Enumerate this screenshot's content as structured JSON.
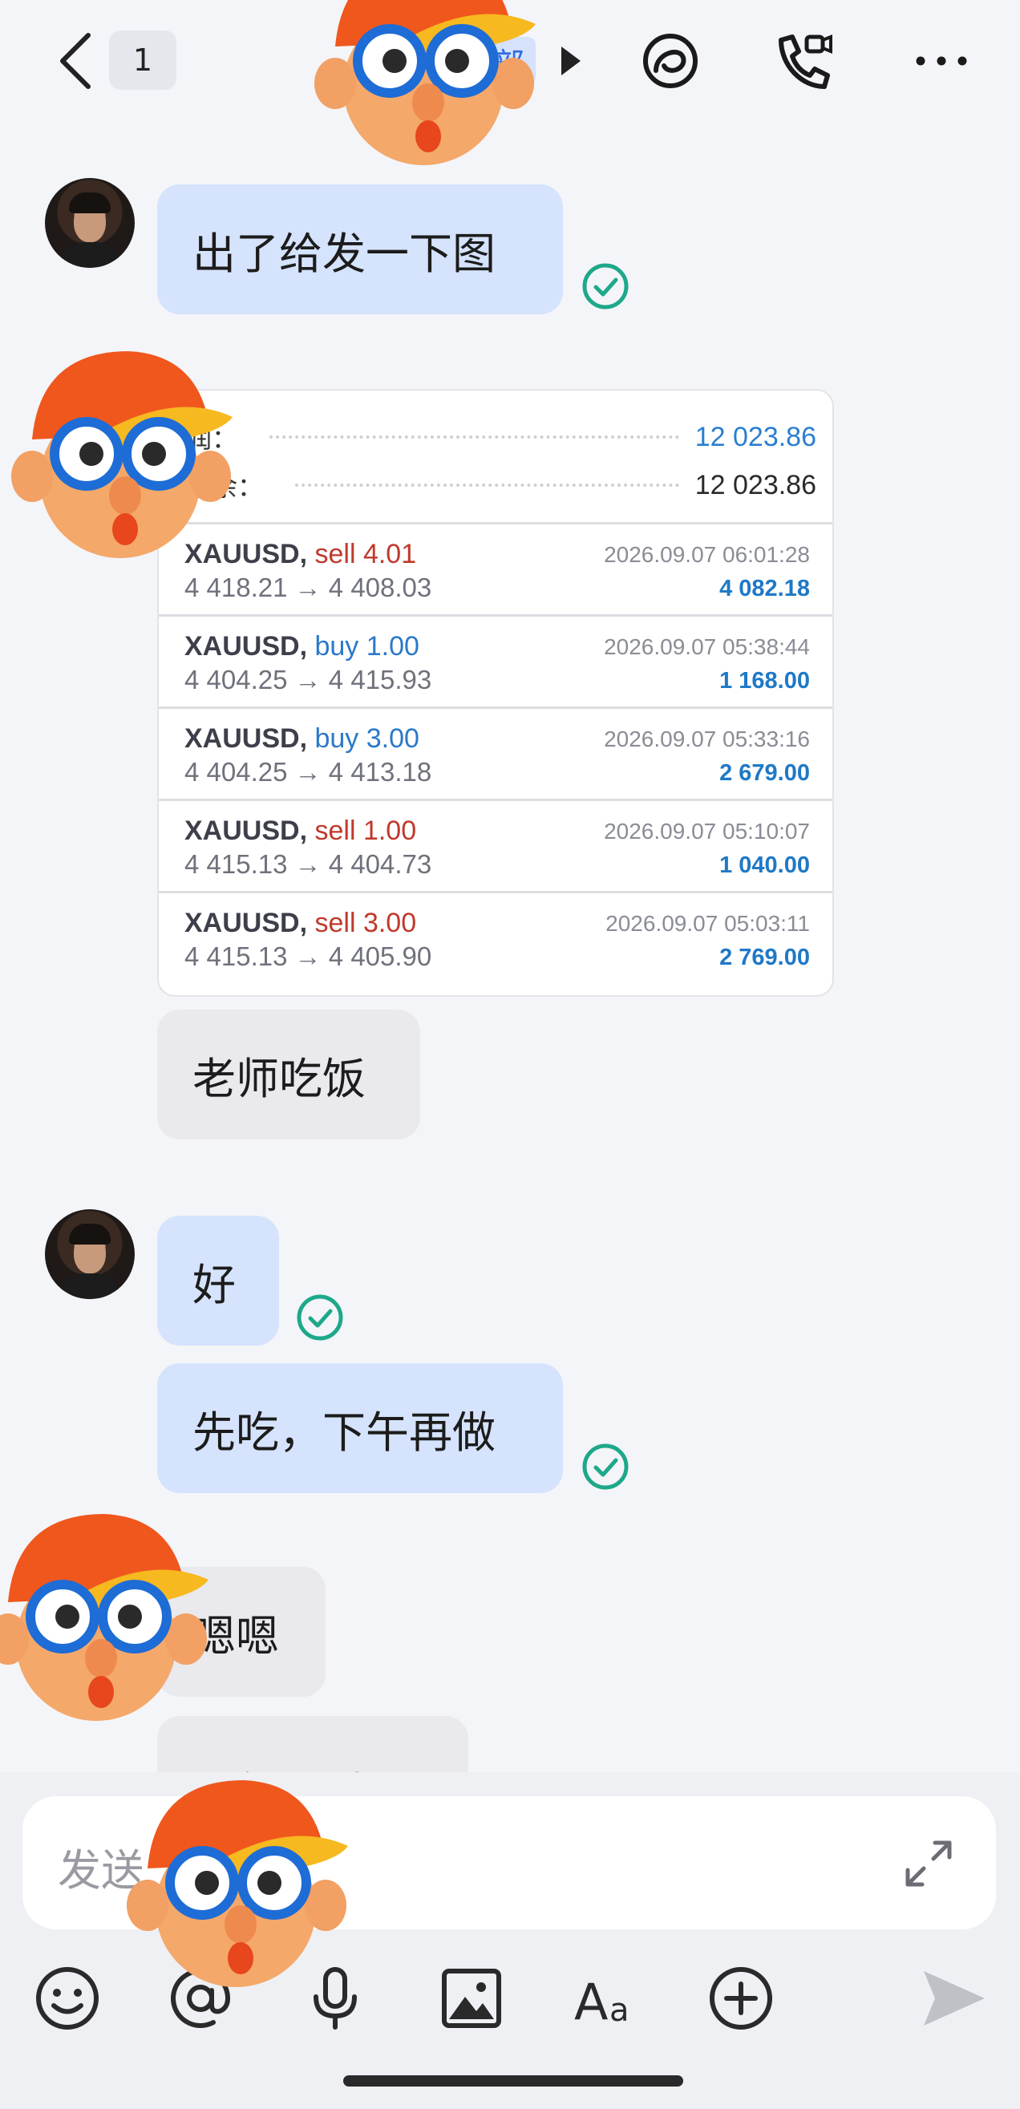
{
  "header": {
    "unread_count": "1",
    "group_tag": "部"
  },
  "messages": [
    {
      "text": "出了给发一下图"
    },
    {
      "text": "老师吃饭"
    },
    {
      "text": "好"
    },
    {
      "text": "先吃，下午再做"
    },
    {
      "text": "嗯嗯"
    },
    {
      "text": "下午看时间"
    }
  ],
  "trade_card": {
    "summary": [
      {
        "label": "润：",
        "value": "12 023.86",
        "value_color": "#2b7ed1"
      },
      {
        "label": "结余：",
        "value": "12 023.86",
        "value_color": "#2a2a2a"
      }
    ],
    "trades": [
      {
        "symbol": "XAUUSD,",
        "side": "sell 4.01",
        "side_color": "#c0392b",
        "prices": "4 418.21 → 4 408.03",
        "time": "2026.09.07 06:01:28",
        "profit": "4 082.18"
      },
      {
        "symbol": "XAUUSD,",
        "side": "buy 1.00",
        "side_color": "#2a79c9",
        "prices": "4 404.25 → 4 415.93",
        "time": "2026.09.07 05:38:44",
        "profit": "1 168.00"
      },
      {
        "symbol": "XAUUSD,",
        "side": "buy 3.00",
        "side_color": "#2a79c9",
        "prices": "4 404.25 → 4 413.18",
        "time": "2026.09.07 05:33:16",
        "profit": "2 679.00"
      },
      {
        "symbol": "XAUUSD,",
        "side": "sell 1.00",
        "side_color": "#c0392b",
        "prices": "4 415.13 → 4 404.73",
        "time": "2026.09.07 05:10:07",
        "profit": "1 040.00"
      },
      {
        "symbol": "XAUUSD,",
        "side": "sell 3.00",
        "side_color": "#c0392b",
        "prices": "4 415.13 → 4 405.90",
        "time": "2026.09.07 05:03:11",
        "profit": "2 769.00"
      }
    ]
  },
  "composer": {
    "placeholder": "发送"
  },
  "icons": {
    "back": "chevron-left-icon",
    "channel": "circle-swirl-icon",
    "call": "phone-video-icon",
    "more": "more-dots-icon",
    "read_receipt": "check-circle-icon",
    "expand": "expand-arrows-icon",
    "emoji": "smile-icon",
    "mention": "at-icon",
    "voice": "microphone-icon",
    "image": "image-icon",
    "font": "font-icon",
    "add": "plus-circle-icon",
    "send": "send-icon"
  },
  "colors": {
    "outgoing_bubble": "#d5e3fc",
    "incoming_bubble": "#e9e9ee",
    "read_check": "#1ea88a",
    "profit_blue": "#1f79c6",
    "sell_red": "#c0392b"
  }
}
